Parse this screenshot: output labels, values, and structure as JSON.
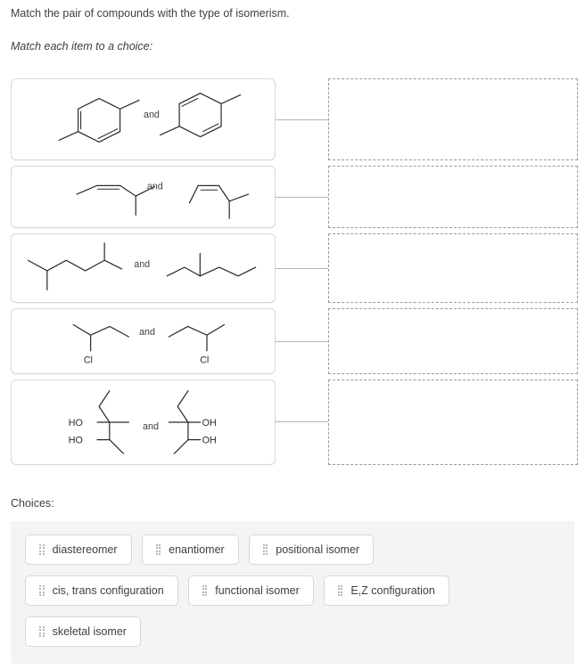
{
  "prompt": "Match the pair of compounds with the type of isomerism.",
  "subprompt": "Match each item to a choice:",
  "choices_label": "Choices:",
  "and_label": "and",
  "items": [
    {
      "id": "item-1",
      "left_structure": "1,4-dimethylcyclohexa-1,3-diene",
      "right_structure": "1,4-dimethylcyclohexa-1,4-diene",
      "connector": "line-to-dropzone-1"
    },
    {
      "id": "item-2",
      "left_structure": "trans-4-methylpent-2-ene",
      "right_structure": "cis-4-methylpent-2-ene",
      "connector": "line-to-dropzone-2"
    },
    {
      "id": "item-3",
      "left_structure": "2,5-dimethylhexane",
      "right_structure": "3-methylheptane",
      "connector": "line-to-dropzone-3"
    },
    {
      "id": "item-4",
      "left_structure": "(R)-2-chlorobutane",
      "right_structure": "(S)-2-chlorobutane",
      "connector": "line-to-dropzone-4"
    },
    {
      "id": "item-5",
      "left_structure": "3-methylpentane-2,3-diol",
      "right_structure": "3-methylpentane-2,3-diol-mirror",
      "connector": "line-to-dropzone-5"
    }
  ],
  "drop_zones": [
    {
      "id": "dropzone-1",
      "value": ""
    },
    {
      "id": "dropzone-2",
      "value": ""
    },
    {
      "id": "dropzone-3",
      "value": ""
    },
    {
      "id": "dropzone-4",
      "value": ""
    },
    {
      "id": "dropzone-5",
      "value": ""
    }
  ],
  "atom_labels": {
    "ho": "HO",
    "oh": "OH",
    "cl": "Cl"
  },
  "choices": [
    {
      "label": "diastereomer"
    },
    {
      "label": "enantiomer"
    },
    {
      "label": "positional isomer"
    },
    {
      "label": "cis, trans configuration"
    },
    {
      "label": "functional isomer"
    },
    {
      "label": "E,Z configuration"
    },
    {
      "label": "skeletal isomer"
    }
  ],
  "colors": {
    "text": "#3f3f3f",
    "card_border": "#d8d8d8",
    "dropzone_border": "#9a9a9a",
    "connector": "#b4b4b4",
    "panel_bg": "#f4f4f4",
    "bond": "#2b2b2b"
  }
}
